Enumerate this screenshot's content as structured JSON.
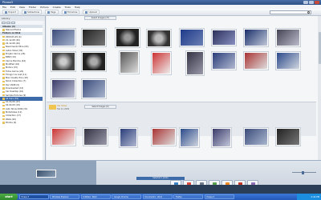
{
  "window": {
    "title": "Picasa3"
  },
  "menu": [
    "File",
    "Edit",
    "View",
    "Folder",
    "Picture",
    "Create",
    "Tools",
    "Help"
  ],
  "toolbar": {
    "import_label": "Import",
    "slideshow_label": "Slideshow",
    "tags_label": "Tags",
    "timeline_label": "Timeline",
    "upload_label": "Upload"
  },
  "library": {
    "header": "Library",
    "groups": [
      {
        "label": "Albums (4)",
        "type": "group"
      },
      {
        "label": "Starred Photos",
        "type": "item"
      },
      {
        "label": "Folders on Disk",
        "type": "group"
      },
      {
        "label": "2009-05-29 (4)",
        "type": "item"
      },
      {
        "label": "21-12-08 (30)",
        "type": "item"
      },
      {
        "label": "22-12-08 (26)",
        "type": "item"
      },
      {
        "label": "Nascimento Mina (93)",
        "type": "item"
      },
      {
        "label": "Autos Show (34)",
        "type": "item"
      },
      {
        "label": "Projeto Carros (26)",
        "type": "item"
      },
      {
        "label": "BMW (19)",
        "type": "item"
      },
      {
        "label": "Carros Bonitos (44)",
        "type": "item"
      },
      {
        "label": "Modified (16)",
        "type": "item"
      },
      {
        "label": "Motors (15)",
        "type": "item"
      },
      {
        "label": "Fotos Carros (24)",
        "type": "item"
      },
      {
        "label": "Things I've Lost (11)",
        "type": "item"
      },
      {
        "label": "Misc Quality Pics (18)",
        "type": "item"
      },
      {
        "label": "Stock Collection (7)",
        "type": "item"
      },
      {
        "label": "Dec 2008 (9)",
        "type": "item"
      },
      {
        "label": "Downloaded (13)",
        "type": "item"
      },
      {
        "label": "Car Desktop (16)",
        "type": "item"
      },
      {
        "label": "Sample Pictures (9)",
        "type": "item"
      },
      {
        "label": "All Cars (34)",
        "type": "selected"
      },
      {
        "label": "01-04-09 (23)",
        "type": "item"
      },
      {
        "label": "02-04-09 (19)",
        "type": "item"
      },
      {
        "label": "Auto Show 2009 (31)",
        "type": "item"
      },
      {
        "label": "Motorbikes (12)",
        "type": "item"
      },
      {
        "label": "Collection (17)",
        "type": "item"
      },
      {
        "label": "Walls (20)",
        "type": "item"
      },
      {
        "label": "Photos (9)",
        "type": "item"
      }
    ]
  },
  "main": {
    "group1_label": "Select Images (17)",
    "group2_label": "Select Images (9)",
    "folder": {
      "name": "Car Show",
      "date": "Feb 14, 2009"
    }
  },
  "bottom": {
    "status": "Selected 1 photo",
    "actions": [
      "Upload",
      "Email",
      "Print",
      "Export",
      "Blog This",
      "Collage",
      "Movie"
    ]
  },
  "taskbar": {
    "start": "start",
    "tasks": [
      "Picasa 3",
      "Windows Explorer",
      "Untitled - Paint",
      "Google Chrome",
      "Document1 - Word",
      "Firefox",
      "Picasa 3"
    ],
    "clock": "2:42 PM"
  },
  "colors": {
    "accent": "#3d6aa8",
    "folder": "#f0c550"
  }
}
